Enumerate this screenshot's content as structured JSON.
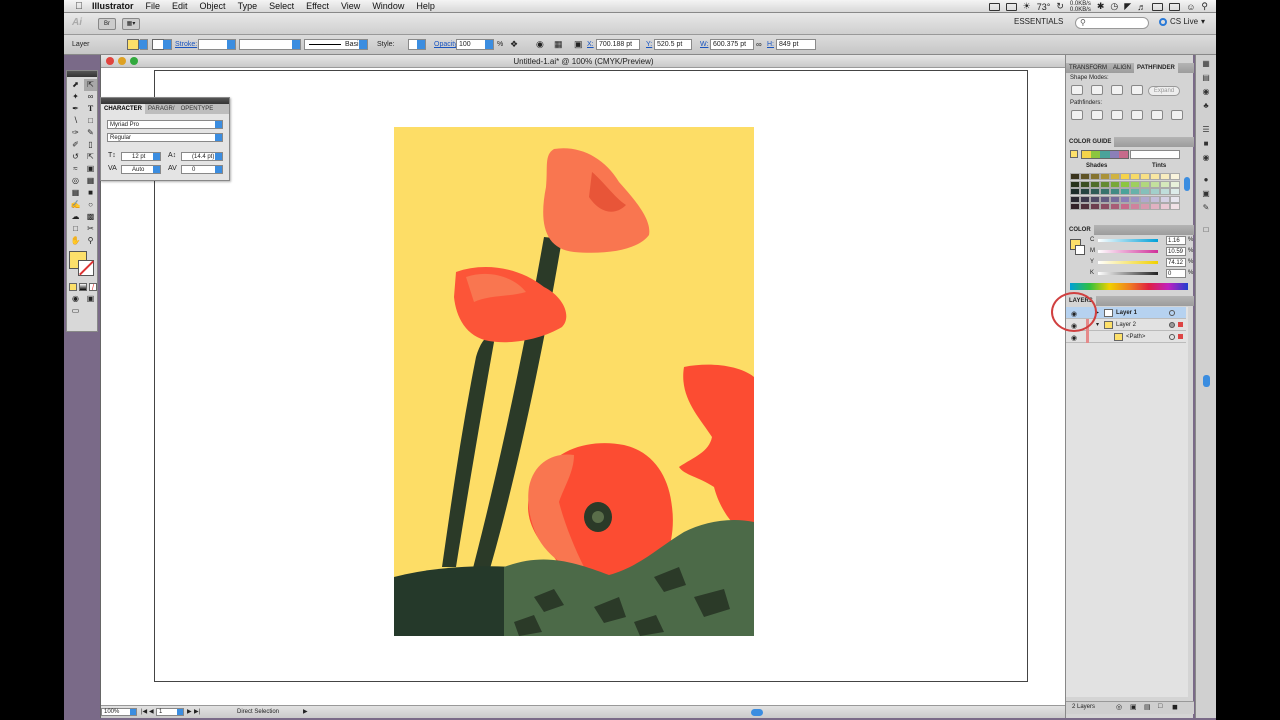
{
  "menubar": {
    "app": "Illustrator",
    "items": [
      "File",
      "Edit",
      "Object",
      "Type",
      "Select",
      "Effect",
      "View",
      "Window",
      "Help"
    ],
    "temperature": "73°",
    "net_up": "0.0KB/s",
    "net_down": "0.0KB/s"
  },
  "appbar": {
    "workspace": "ESSENTIALS",
    "cs_live": "CS Live"
  },
  "control": {
    "selection_type": "Layer",
    "stroke_label": "Stroke:",
    "brush": "Basic",
    "style_label": "Style:",
    "opacity_label": "Opacity:",
    "opacity_value": "100",
    "opacity_unit": "%",
    "x_label": "X:",
    "x_value": "700.188 pt",
    "y_label": "Y:",
    "y_value": "520.5 pt",
    "w_label": "W:",
    "w_value": "600.375 pt",
    "h_label": "H:",
    "h_value": "849 pt",
    "fill_color": "#fde06a"
  },
  "character_panel": {
    "tabs": [
      "CHARACTER",
      "PARAGR/",
      "OPENTYPE"
    ],
    "font_family": "Myriad Pro",
    "font_style": "Regular",
    "font_size": "12 pt",
    "leading": "(14.4 pt)",
    "kerning": "Auto",
    "tracking": "0"
  },
  "document": {
    "title": "Untitled-1.ai* @ 100% (CMYK/Preview)",
    "zoom": "100%",
    "artboard_num": "1",
    "status_tool": "Direct Selection"
  },
  "pathfinder_panel": {
    "tabs": [
      "TRANSFORM",
      "ALIGN",
      "PATHFINDER"
    ],
    "shape_modes_label": "Shape Modes:",
    "pathfinders_label": "Pathfinders:",
    "expand_label": "Expand"
  },
  "color_guide_panel": {
    "title": "COLOR GUIDE",
    "shades_label": "Shades",
    "tints_label": "Tints",
    "harmony_colors": [
      "#f5d34a",
      "#8cc63f",
      "#4aa39a",
      "#8b7fb8",
      "#c66a8a"
    ]
  },
  "color_panel": {
    "title": "COLOR",
    "channels": [
      {
        "label": "C",
        "value": "1.16",
        "color": "#00a0d8"
      },
      {
        "label": "M",
        "value": "10.59",
        "color": "#d0309a"
      },
      {
        "label": "Y",
        "value": "74.12",
        "color": "#f0d000"
      },
      {
        "label": "K",
        "value": "0",
        "color": "#222222"
      }
    ],
    "unit": "%"
  },
  "layers_panel": {
    "title": "LAYERS",
    "layers": [
      {
        "name": "Layer 1",
        "selected": true
      },
      {
        "name": "Layer 2",
        "selected": false
      },
      {
        "name": "<Path>",
        "selected": false
      }
    ],
    "count": "2 Layers"
  }
}
